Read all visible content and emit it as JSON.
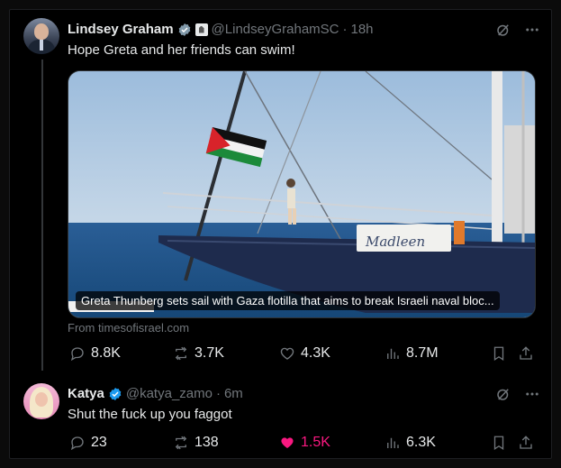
{
  "tweet1": {
    "author_name": "Lindsey Graham",
    "handle": "@LindseyGrahamSC",
    "sep": "·",
    "time": "18h",
    "text": "Hope Greta and her friends can swim!",
    "card": {
      "caption": "Greta Thunberg sets sail with Gaza flotilla that aims to break Israeli naval bloc...",
      "boat_name": "Madleen",
      "source": "From timesofisrael.com"
    },
    "stats": {
      "replies": "8.8K",
      "reposts": "3.7K",
      "likes": "4.3K",
      "views": "8.7M"
    }
  },
  "tweet2": {
    "author_name": "Katya",
    "handle": "@katya_zamo",
    "sep": "·",
    "time": "6m",
    "text": "Shut the fuck up you faggot",
    "stats": {
      "replies": "23",
      "reposts": "138",
      "likes": "1.5K",
      "views": "6.3K"
    }
  },
  "colors": {
    "background": "#000000",
    "text": "#e7e9ea",
    "muted": "#71767b",
    "verified": "#1d9bf0",
    "like_active": "#f91880"
  },
  "icons": [
    "grok-icon",
    "more-icon",
    "reply-icon",
    "repost-icon",
    "like-icon",
    "views-icon",
    "bookmark-icon",
    "share-icon",
    "verified-badge-icon",
    "government-badge-icon"
  ]
}
